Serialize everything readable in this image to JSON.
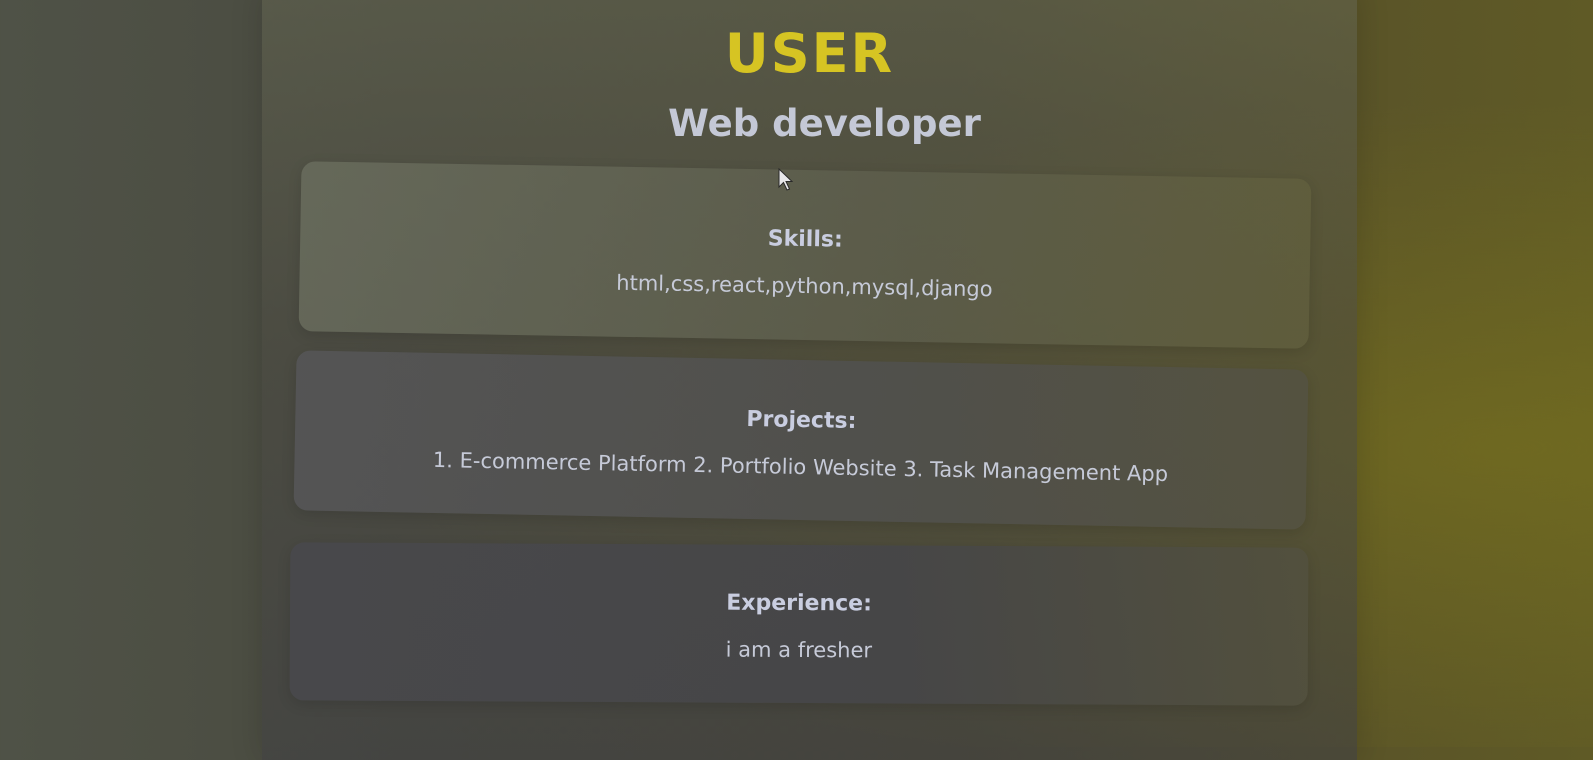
{
  "profile": {
    "name": "USER",
    "role": "Web developer"
  },
  "sections": {
    "skills": {
      "title": "Skills:",
      "content": "html,css,react,python,mysql,django"
    },
    "projects": {
      "title": "Projects:",
      "content": "1. E-commerce Platform 2. Portfolio Website 3. Task Management App"
    },
    "experience": {
      "title": "Experience:",
      "content": "i am a fresher"
    }
  },
  "colors": {
    "name_accent": "#d6c423",
    "text": "#c6cad8",
    "card_background": "#4f4f52"
  },
  "icons": {
    "cursor": "mouse-pointer-icon"
  }
}
